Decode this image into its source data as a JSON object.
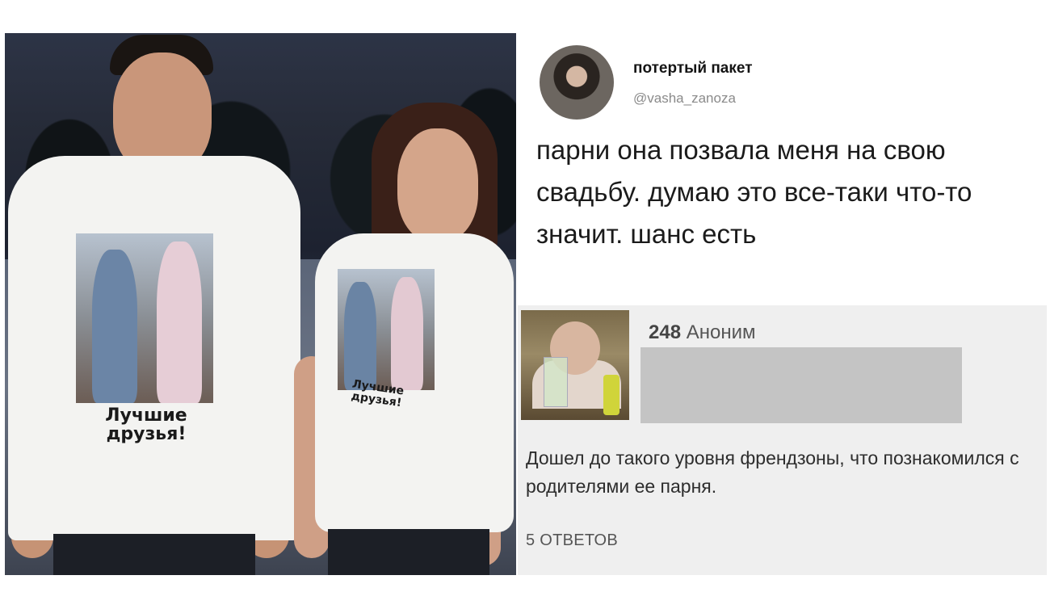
{
  "photo": {
    "shirt_text_line1": "Лучшие",
    "shirt_text_line2": "друзья!"
  },
  "tweet": {
    "display_name": "потертый пакет",
    "handle": "@vasha_zanoza",
    "text": "парни она позвала меня на свою свадьбу. думаю это все-таки что-то значит. шанс есть"
  },
  "comment": {
    "reply_number": "248",
    "author": "Аноним",
    "text": "Дошел до такого уровня френдзоны, что познакомился с родителями ее парня.",
    "replies_label": "5 ОТВЕТОВ"
  },
  "colors": {
    "card_background": "#efefef",
    "redaction_bar": "#c4c4c4",
    "handle_gray": "#8a8a8a"
  }
}
